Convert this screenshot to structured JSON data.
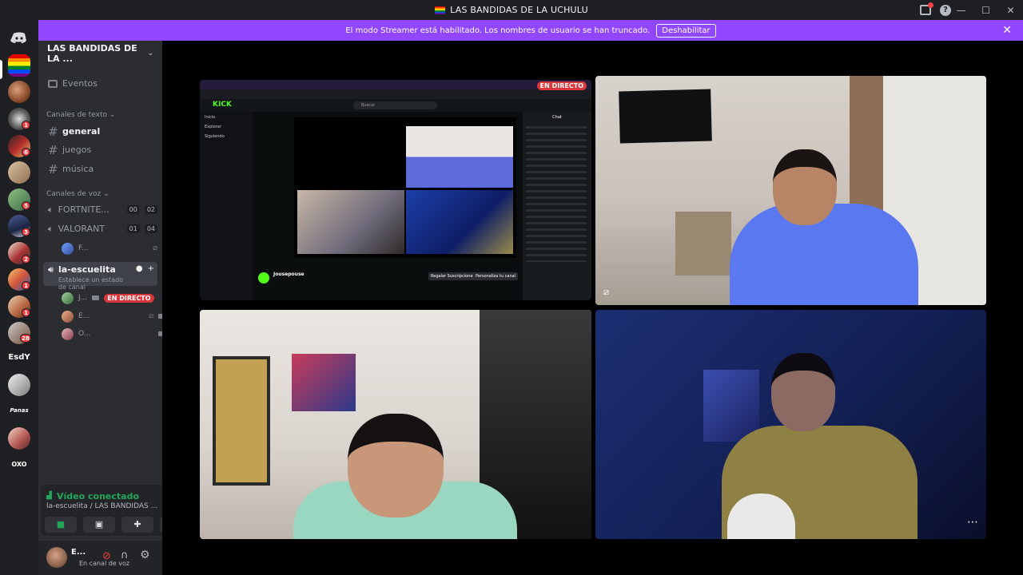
{
  "window": {
    "title": "LAS BANDIDAS DE LA UCHULU",
    "minimize": "—",
    "maximize": "☐",
    "close": "✕",
    "help": "?"
  },
  "banner": {
    "message": "El modo Streamer está habilitado. Los nombres de usuario se han truncado.",
    "button": "Deshabilitar",
    "close": "✕"
  },
  "rail": {
    "text_servers": [
      "EsdY",
      "Panas",
      "OXO"
    ],
    "badges": [
      "1",
      "6",
      "5",
      "3",
      "2",
      "1",
      "1",
      "28"
    ]
  },
  "sidebar": {
    "server_name": "LAS BANDIDAS DE LA ...",
    "events": "Eventos",
    "text_category": "Canales de texto",
    "text_channels": [
      "general",
      "juegos",
      "música"
    ],
    "voice_category": "Canales de voz",
    "voice_channels": [
      {
        "name": "FORTNITE...",
        "count_a": "00",
        "count_b": "02"
      },
      {
        "name": "VALORANT",
        "count_a": "01",
        "count_b": "04"
      }
    ],
    "valorant_user": "F...",
    "active_channel": {
      "name": "la-escuelita",
      "status": "Establece un estado de canal"
    },
    "channel_users": [
      {
        "name": "J...",
        "live": "EN DIRECTO"
      },
      {
        "name": "E..."
      },
      {
        "name": "O..."
      }
    ]
  },
  "voice_panel": {
    "status": "Vídeo conectado",
    "location": "la-escuelita / LAS BANDIDAS ..."
  },
  "user": {
    "name": "E...",
    "status": "En canal de voz"
  },
  "stream": {
    "live_badge": "EN DIRECTO",
    "kick_logo": "KICK",
    "search": "Buscar",
    "streamer": "Jousepouse",
    "subscribe": "Regalar Suscripciones",
    "customize": "Personaliza tu canal",
    "chat_title": "Chat",
    "nav": [
      "Inicio",
      "Explorar",
      "Siguiendo"
    ]
  },
  "tiles": {
    "more": "⋯"
  },
  "colors": {
    "brand_purple": "#9147ff",
    "voice_green": "#23a55a",
    "live_red": "#da373c",
    "kick_green": "#53fc18"
  }
}
